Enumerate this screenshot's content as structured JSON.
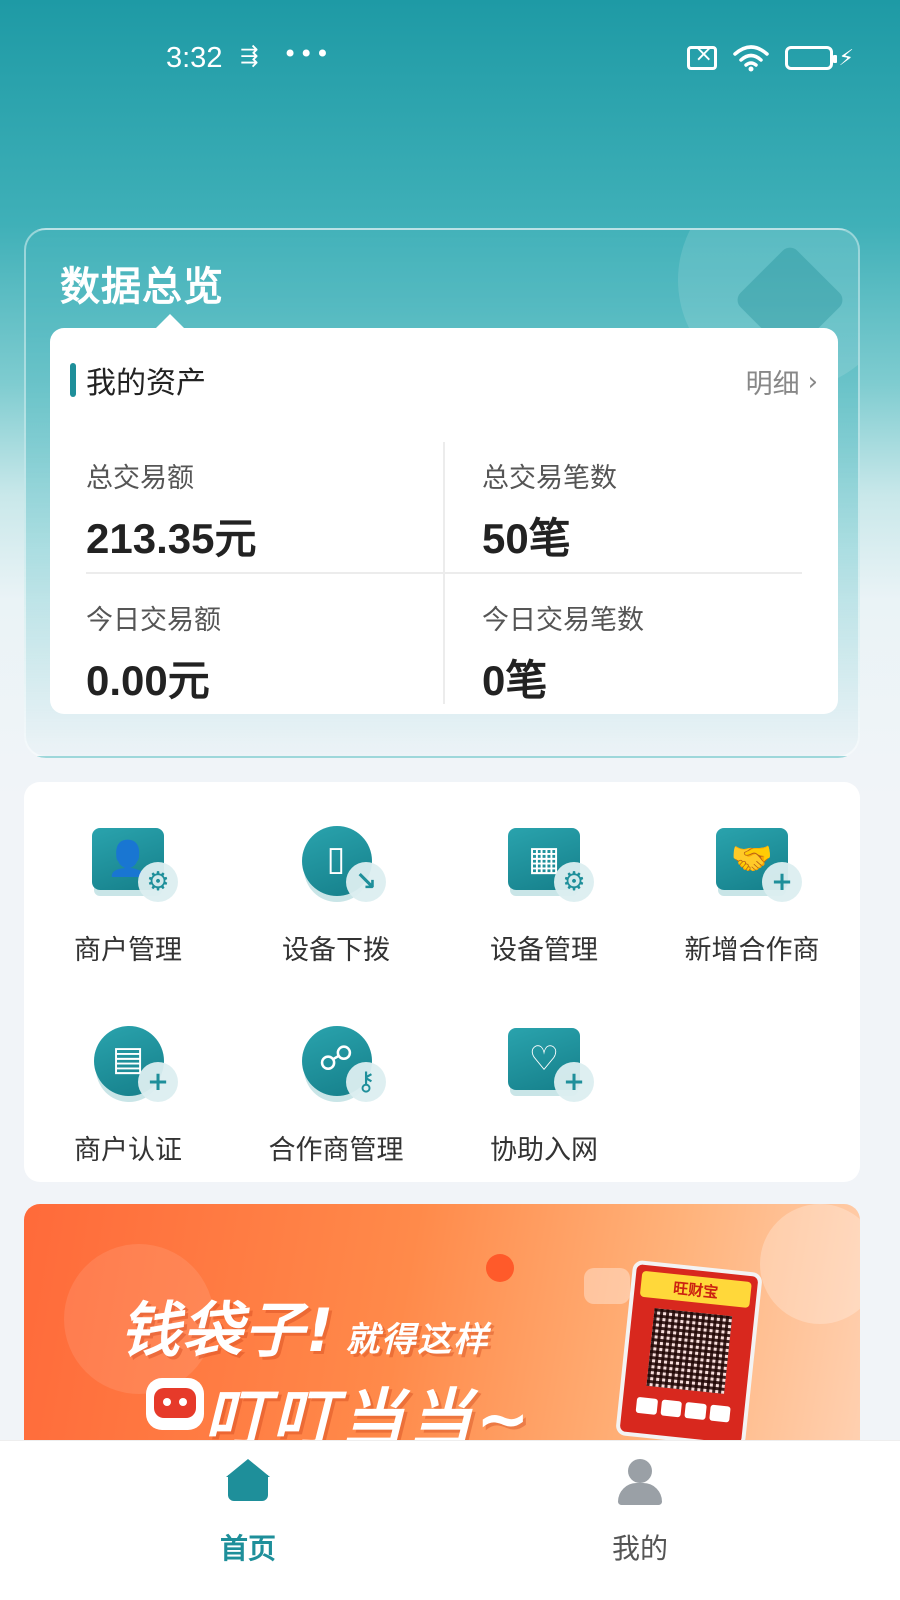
{
  "status_bar": {
    "time": "3:32",
    "usb_glyph": "⇶",
    "dots": "•••",
    "icons": [
      "sim-off-icon",
      "wifi-icon",
      "battery-icon",
      "charging-icon"
    ]
  },
  "overview": {
    "title": "数据总览",
    "asset_title": "我的资产",
    "detail_link": "明细",
    "stats": [
      {
        "label": "总交易额",
        "amount": "213.35",
        "unit": "元"
      },
      {
        "label": "总交易笔数",
        "amount": "50",
        "unit": "笔"
      },
      {
        "label": "今日交易额",
        "amount": "0.00",
        "unit": "元"
      },
      {
        "label": "今日交易笔数",
        "amount": "0",
        "unit": "笔"
      }
    ]
  },
  "menu": {
    "items": [
      {
        "label": "商户管理",
        "icon": "merchant-settings-icon"
      },
      {
        "label": "设备下拨",
        "icon": "device-dispatch-icon"
      },
      {
        "label": "设备管理",
        "icon": "device-settings-icon"
      },
      {
        "label": "新增合作商",
        "icon": "add-partner-icon"
      },
      {
        "label": "商户认证",
        "icon": "merchant-verify-icon"
      },
      {
        "label": "合作商管理",
        "icon": "partner-manage-icon"
      },
      {
        "label": "协助入网",
        "icon": "assist-onboarding-icon"
      }
    ]
  },
  "banner": {
    "line1": "钱袋子!",
    "line1_small": "就得这样",
    "line2": "叮叮当当~",
    "device_brand": "旺财宝"
  },
  "tab_bar": {
    "tabs": [
      {
        "label": "首页",
        "icon": "home-icon",
        "active": true,
        "color": "#1e8f9a"
      },
      {
        "label": "我的",
        "icon": "profile-icon",
        "active": false,
        "color": "#555555"
      }
    ]
  },
  "colors": {
    "accent": "#1e8f9a",
    "header_gradient_top": "#1e9aa5",
    "banner_orange": "#ff6a3a"
  }
}
